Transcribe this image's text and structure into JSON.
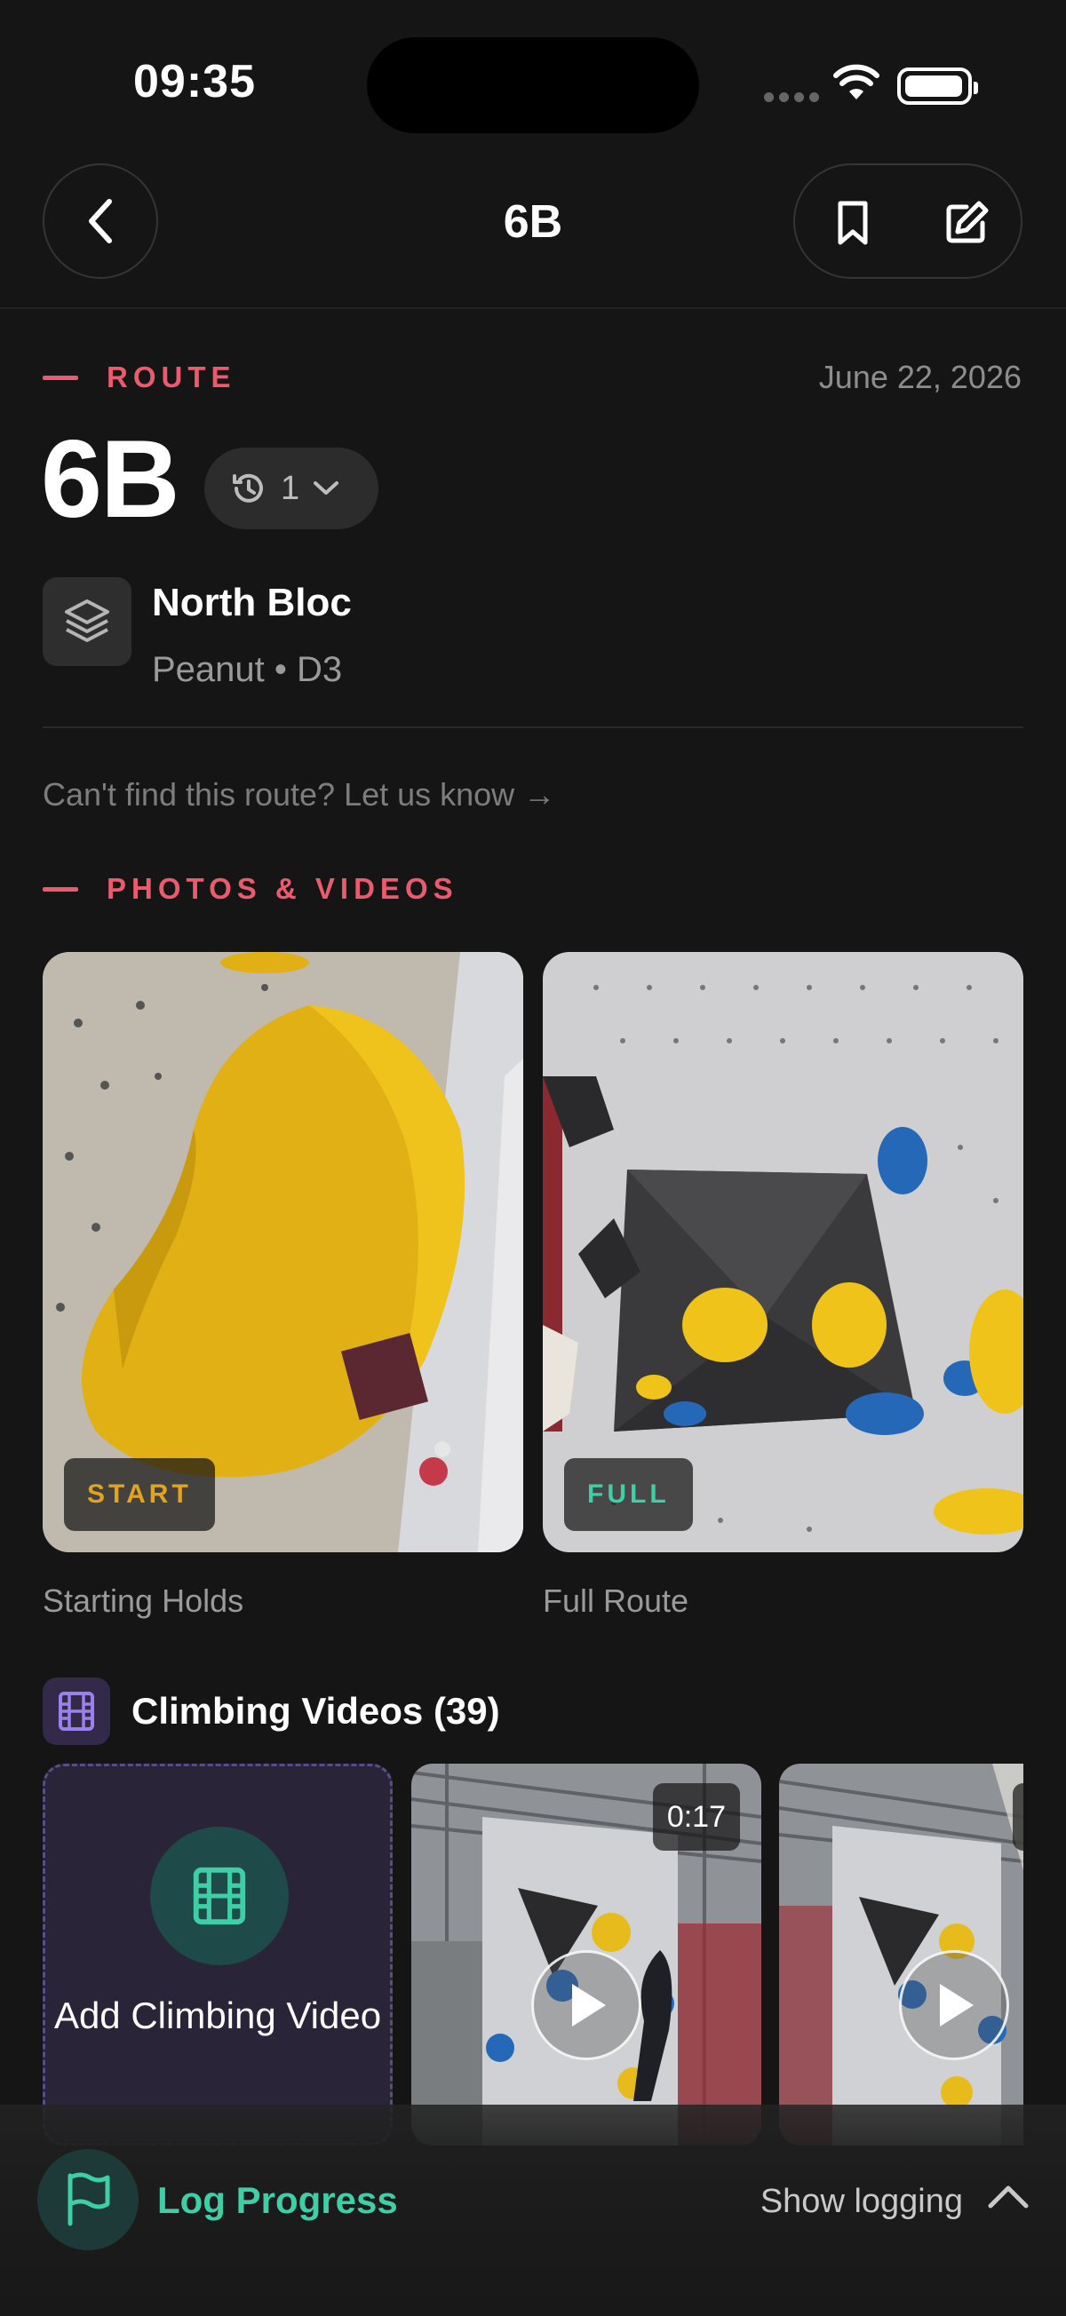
{
  "status_bar": {
    "time": "09:35"
  },
  "nav": {
    "title": "6B",
    "icons": [
      "chevron-left-icon",
      "bookmark-icon",
      "edit-icon"
    ]
  },
  "route": {
    "section_label": "ROUTE",
    "date": "June 22, 2026",
    "grade": "6B",
    "history_count": "1",
    "gym_name": "North Bloc",
    "gym_sub": "Peanut • D3",
    "report_link": "Can't find this route? Let us know →"
  },
  "media": {
    "section_label": "PHOTOS & VIDEOS",
    "photos": [
      {
        "badge": "START",
        "badge_color": "#e0a41f",
        "caption": "Starting Holds"
      },
      {
        "badge": "FULL",
        "badge_color": "#3fcfa7",
        "caption": "Full Route"
      }
    ],
    "videos_title": "Climbing Videos (39)",
    "add_video_label": "Add Climbing Video",
    "videos": [
      {
        "duration": "0:17"
      },
      {
        "duration": ""
      }
    ]
  },
  "log_bar": {
    "label": "Log Progress",
    "toggle": "Show logging"
  },
  "colors": {
    "accent_red": "#ec5a6e",
    "accent_teal": "#3fcfa7",
    "accent_purple": "#8a6fe0",
    "background": "#151515"
  }
}
